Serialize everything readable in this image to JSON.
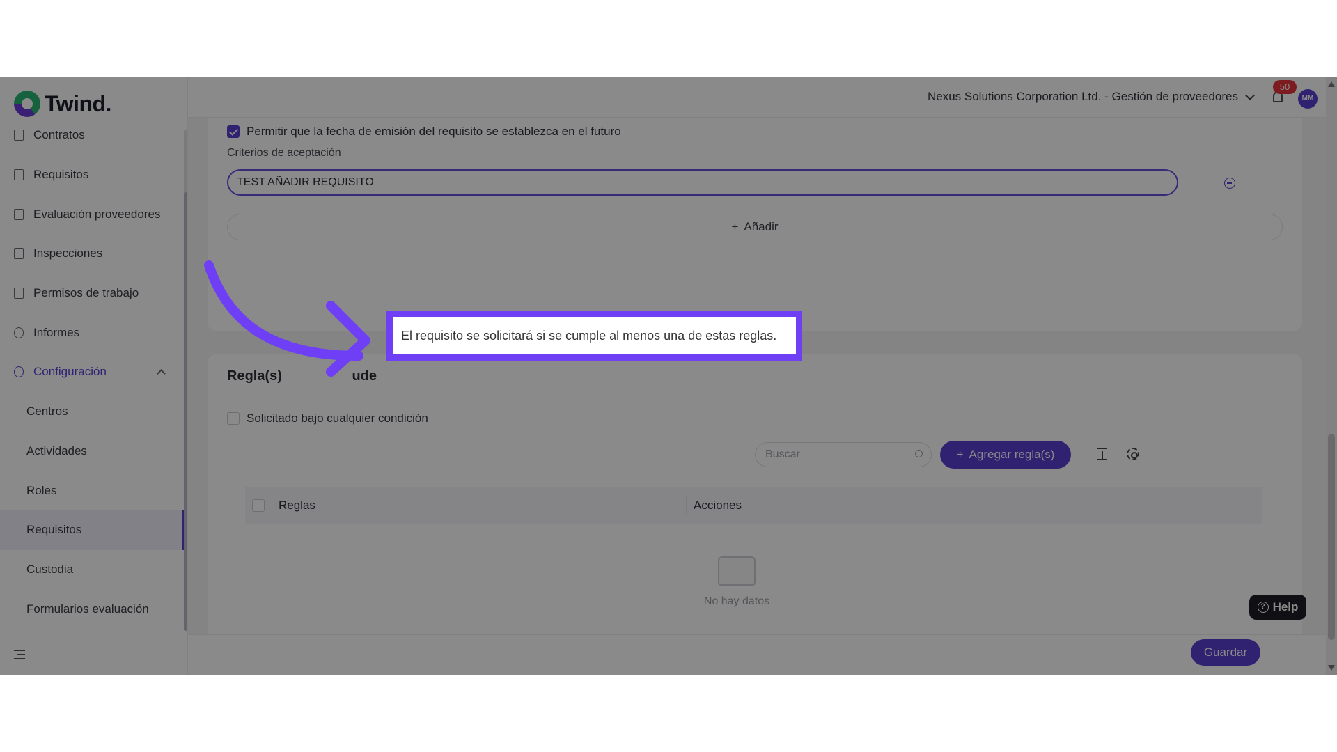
{
  "app": {
    "logo_text": "Twind.",
    "org_selector": "Nexus Solutions Corporation Ltd. - Gestión de proveedores",
    "notifications_count": "50",
    "avatar_initials": "MM"
  },
  "sidebar": {
    "items": [
      {
        "label": "Contratos",
        "icon": "contract-icon"
      },
      {
        "label": "Requisitos",
        "icon": "document-icon"
      },
      {
        "label": "Evaluación proveedores",
        "icon": "shield-icon"
      },
      {
        "label": "Inspecciones",
        "icon": "inspection-icon"
      },
      {
        "label": "Permisos de trabajo",
        "icon": "shield-icon"
      },
      {
        "label": "Informes",
        "icon": "chart-icon"
      },
      {
        "label": "Configuración",
        "icon": "gear-icon",
        "expanded": true
      }
    ],
    "sub_items": [
      {
        "label": "Centros"
      },
      {
        "label": "Actividades"
      },
      {
        "label": "Roles"
      },
      {
        "label": "Requisitos",
        "active": true
      },
      {
        "label": "Custodia"
      },
      {
        "label": "Formularios evaluación"
      }
    ]
  },
  "form": {
    "future_date_checkbox_label": "Permitir que la fecha de emisión del requisito se establezca en el futuro",
    "future_date_checked": true,
    "criteria_label": "Criterios de aceptación",
    "criteria_value": "TEST AÑADIR REQUISITO",
    "add_label": "Añadir"
  },
  "rules": {
    "title": "Regla(s) ",
    "title_tail": "ude",
    "any_condition_label": "Solicitado bajo cualquier condición",
    "any_condition_checked": false,
    "search_placeholder": "Buscar",
    "add_rule_label": "Agregar regla(s)",
    "columns": [
      "Reglas",
      "Acciones"
    ],
    "empty_text": "No hay datos"
  },
  "footer": {
    "save_label": "Guardar",
    "help_label": "Help"
  },
  "tooltip": {
    "text": "El requisito se solicitará si se cumple al menos una de estas reglas.",
    "accent_color": "#6f3ff5"
  },
  "colors": {
    "brand": "#5b3fd1"
  }
}
